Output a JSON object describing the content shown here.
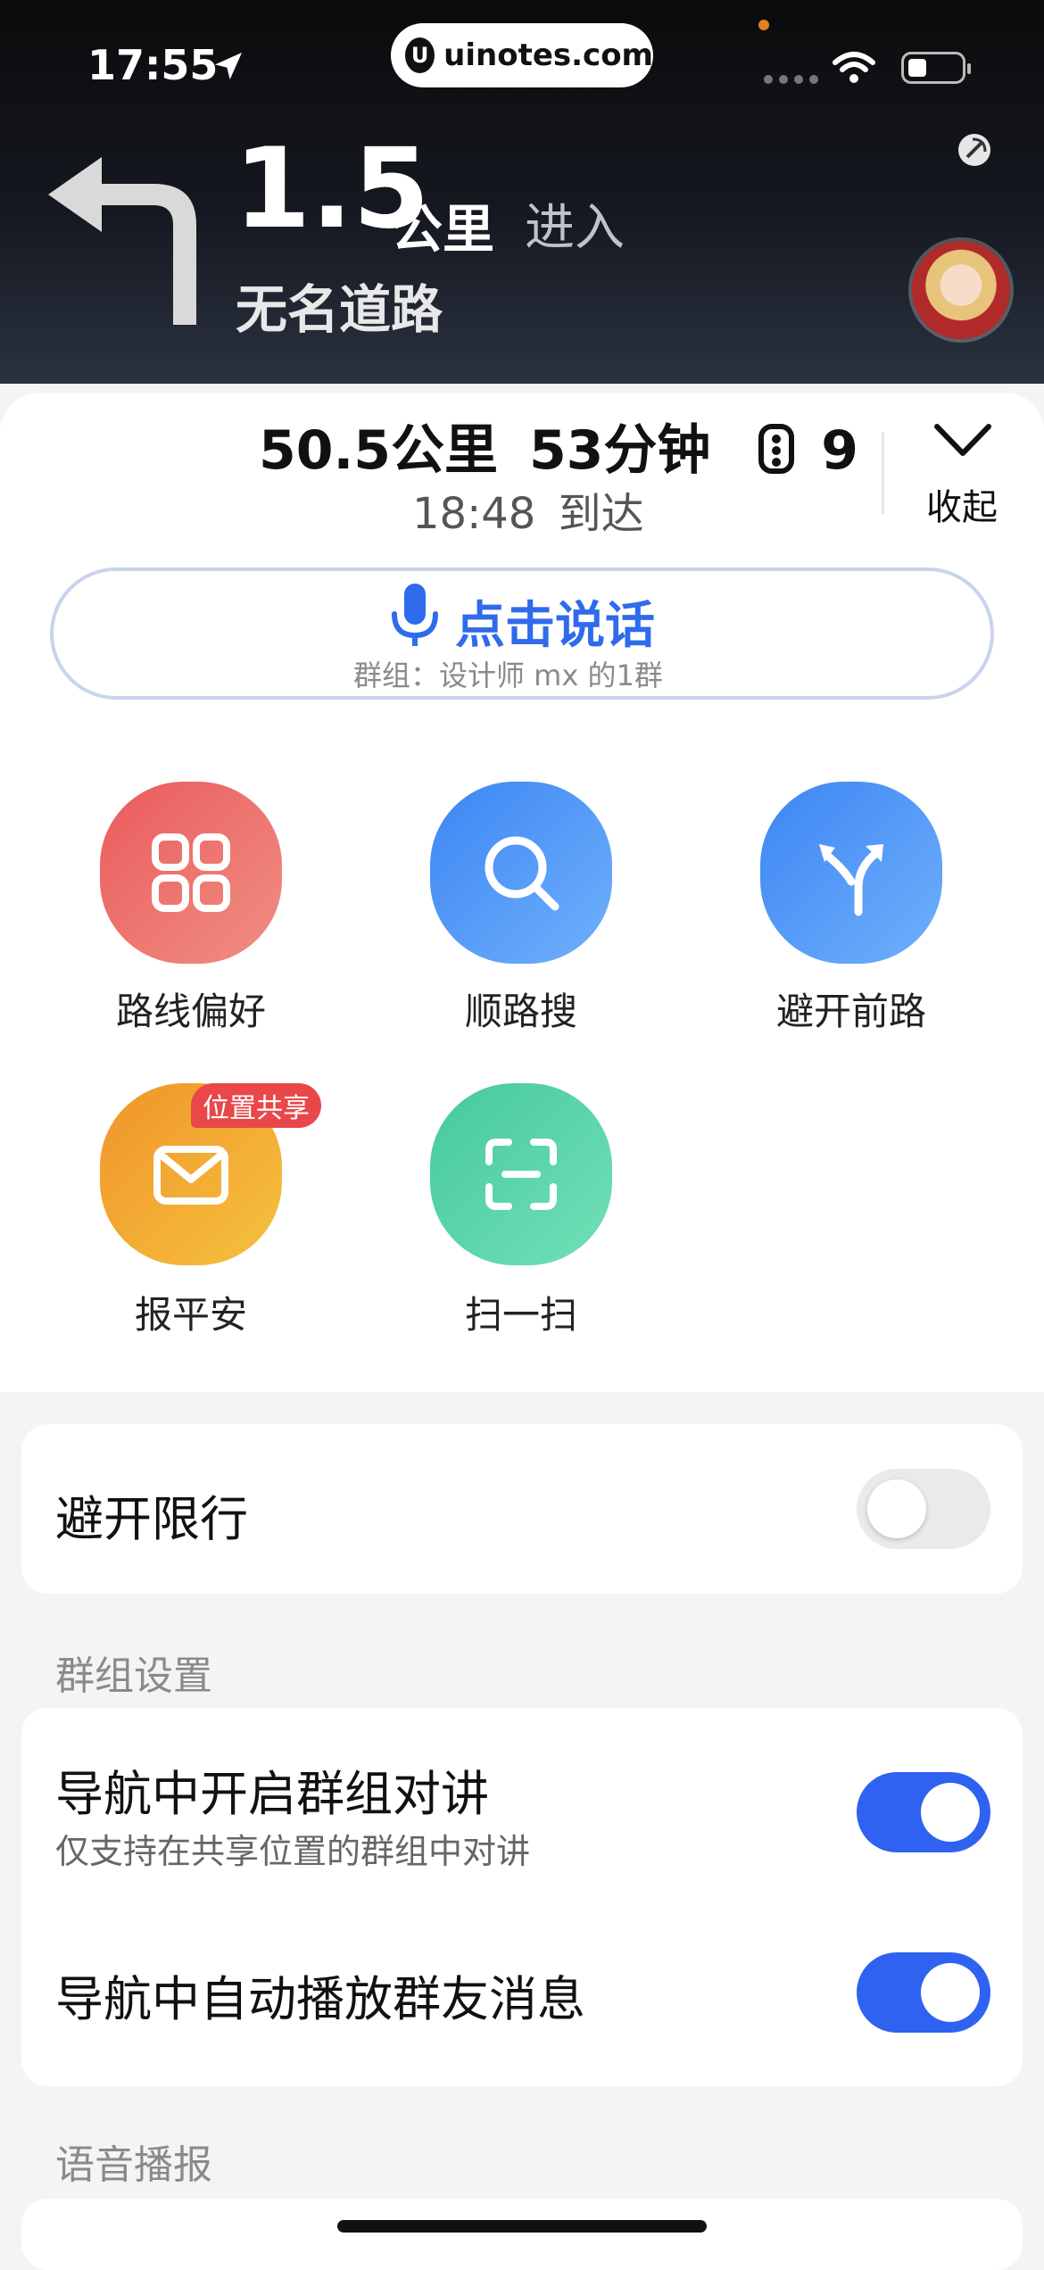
{
  "status_bar": {
    "time": "17:55",
    "url": "uinotes.com"
  },
  "navigation": {
    "distance_value": "1.5",
    "distance_unit": "公里",
    "action": "进入",
    "road_name": "无名道路"
  },
  "route_summary": {
    "distance": "50.5公里",
    "duration": "53分钟",
    "traffic_lights": "9",
    "arrival_time": "18:48",
    "arrival_suffix": "到达",
    "collapse_label": "收起"
  },
  "talk": {
    "label": "点击说话",
    "group_caption": "群组：设计师 mx 的1群"
  },
  "actions": [
    {
      "label": "路线偏好",
      "icon": "grid-icon",
      "color": "#ee6b6b"
    },
    {
      "label": "顺路搜",
      "icon": "search-icon",
      "color": "#4b93f6"
    },
    {
      "label": "避开前路",
      "icon": "split-road-icon",
      "color": "#4b93f6"
    },
    {
      "label": "报平安",
      "icon": "envelope-icon",
      "color": "#f3a432",
      "badge": "位置共享"
    },
    {
      "label": "扫一扫",
      "icon": "scan-icon",
      "color": "#4dd0a3"
    }
  ],
  "settings": {
    "avoid_restriction": {
      "label": "避开限行",
      "enabled": false
    },
    "group_section_title": "群组设置",
    "group_talk": {
      "label": "导航中开启群组对讲",
      "sub": "仅支持在共享位置的群组中对讲",
      "enabled": true
    },
    "auto_play": {
      "label": "导航中自动播放群友消息",
      "enabled": true
    },
    "voice_section_title": "语音播报"
  },
  "colors": {
    "accent": "#2f62f0",
    "talk_text": "#2f6bea"
  }
}
